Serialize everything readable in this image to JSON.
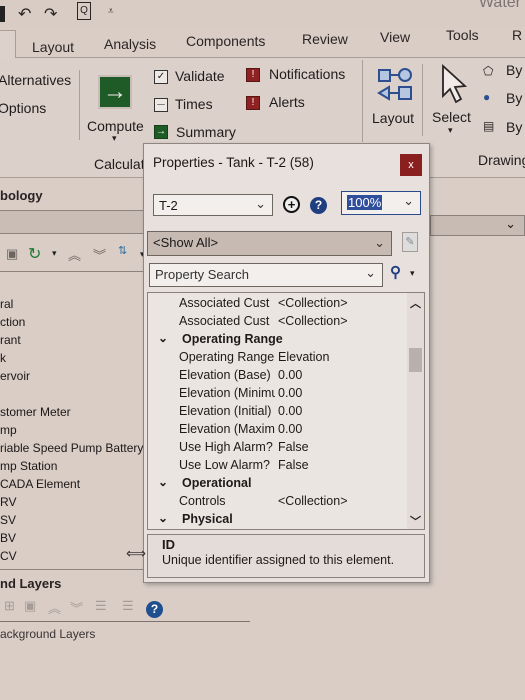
{
  "app": {
    "title_fragment": "Water",
    "quick_access": [
      "undo-icon",
      "redo-icon",
      "print-preview-icon",
      "customize-qat-icon"
    ]
  },
  "ribbon": {
    "tabs": [
      "Layout",
      "Analysis",
      "Components",
      "Review",
      "View",
      "Tools",
      "R"
    ],
    "left_group": {
      "items": [
        "Alternatives",
        "Options"
      ]
    },
    "calculation_group": {
      "label": "Calculat",
      "compute_label": "Compute",
      "items": [
        {
          "label": "Validate",
          "icon": "validate-icon"
        },
        {
          "label": "Times",
          "icon": "times-icon"
        },
        {
          "label": "Summary",
          "icon": "summary-icon"
        },
        {
          "label": "Notifications",
          "icon": "notifications-icon"
        },
        {
          "label": "Alerts",
          "icon": "alerts-icon"
        }
      ]
    },
    "layout_label": "Layout",
    "select_label": "Select",
    "by_items": [
      "By",
      "By",
      "By"
    ],
    "drawing_label": "Drawing"
  },
  "left_panel": {
    "title": "bology",
    "element_types": [
      "ral",
      "ction",
      "rant",
      "k",
      "ervoir",
      "",
      "stomer Meter",
      "mp",
      "riable Speed Pump Battery",
      "mp Station",
      "CADA Element",
      "RV",
      "SV",
      "BV",
      "CV"
    ],
    "layers_title": "nd Layers",
    "background_layers_label": "ackground Layers"
  },
  "dialog": {
    "title": "Properties - Tank - T-2 (58)",
    "close_label": "x",
    "element_select": "T-2",
    "zoom_value": "100%",
    "filter_value": "<Show All>",
    "search_placeholder": "Property Search",
    "rows": [
      {
        "type": "prop",
        "name": "Associated Cust",
        "value": "<Collection>"
      },
      {
        "type": "prop",
        "name": "Associated Cust",
        "value": "<Collection>"
      },
      {
        "type": "cat",
        "name": "Operating Range"
      },
      {
        "type": "prop",
        "name": "Operating Range",
        "value": "Elevation"
      },
      {
        "type": "prop",
        "name": "Elevation (Base)",
        "value": "0.00"
      },
      {
        "type": "prop",
        "name": "Elevation (Minimum)",
        "value": "0.00"
      },
      {
        "type": "prop",
        "name": "Elevation (Initial)",
        "value": "0.00"
      },
      {
        "type": "prop",
        "name": "Elevation (Maximum)",
        "value": "0.00"
      },
      {
        "type": "prop",
        "name": "Use High Alarm?",
        "value": "False"
      },
      {
        "type": "prop",
        "name": "Use Low Alarm?",
        "value": "False"
      },
      {
        "type": "cat",
        "name": "Operational"
      },
      {
        "type": "prop",
        "name": "Controls",
        "value": "<Collection>"
      },
      {
        "type": "cat",
        "name": "Physical"
      }
    ],
    "description": {
      "title": "ID",
      "text": "Unique identifier assigned to this element."
    }
  }
}
